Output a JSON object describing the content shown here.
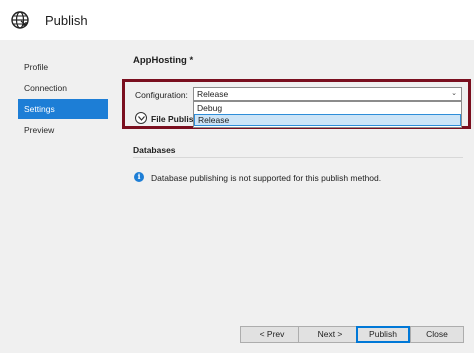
{
  "window": {
    "title": "Publish"
  },
  "nav": {
    "items": [
      {
        "label": "Profile",
        "active": false
      },
      {
        "label": "Connection",
        "active": false
      },
      {
        "label": "Settings",
        "active": true
      },
      {
        "label": "Preview",
        "active": false
      }
    ]
  },
  "settings": {
    "profile_name": "AppHosting *",
    "configuration_label": "Configuration:",
    "configuration_value": "Release",
    "configuration_options": [
      "Debug",
      "Release"
    ],
    "file_publish_label": "File Publish Options"
  },
  "databases": {
    "heading": "Databases",
    "info_message": "Database publishing is not supported for this publish method."
  },
  "buttons": {
    "prev": "< Prev",
    "next": "Next >",
    "publish": "Publish",
    "close": "Close"
  },
  "colors": {
    "accent": "#1d7ed6",
    "highlight_border": "#7a0f1f"
  },
  "icons": {
    "app": "globe-icon",
    "expander": "chevron-down-icon",
    "info": "info-icon"
  }
}
